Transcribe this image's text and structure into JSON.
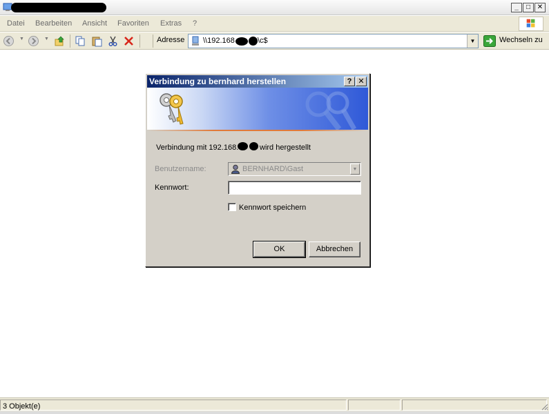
{
  "window": {
    "title_redacted": true,
    "controls": {
      "minimize": "_",
      "maximize": "□",
      "close": "✕"
    }
  },
  "menu": {
    "items": [
      "Datei",
      "Bearbeiten",
      "Ansicht",
      "Favoriten",
      "Extras",
      "?"
    ]
  },
  "toolbar": {
    "icons": [
      "back-icon",
      "forward-icon",
      "up-folder-icon",
      "copy-icon",
      "paste-icon",
      "cut-icon",
      "delete-icon"
    ],
    "address_label": "Adresse",
    "address_value": "\\\\192.168",
    "address_suffix": "\\c$",
    "go_label": "Wechseln zu"
  },
  "dialog": {
    "title": "Verbindung zu bernhard herstellen",
    "help_button": "?",
    "close_button": "✕",
    "message_prefix": "Verbindung mit 192.168.",
    "message_suffix": "wird hergestellt",
    "username_label": "Benutzername:",
    "username_value": "BERNHARD\\Gast",
    "password_label": "Kennwort:",
    "password_value": "",
    "remember_label": "Kennwort speichern",
    "remember_checked": false,
    "ok_label": "OK",
    "cancel_label": "Abbrechen"
  },
  "statusbar": {
    "objects": "3 Objekt(e)"
  },
  "colors": {
    "dialog_title_start": "#0a246a",
    "dialog_title_end": "#a6caf0",
    "chrome": "#ece9d8",
    "dialog_face": "#d4d0c8"
  }
}
